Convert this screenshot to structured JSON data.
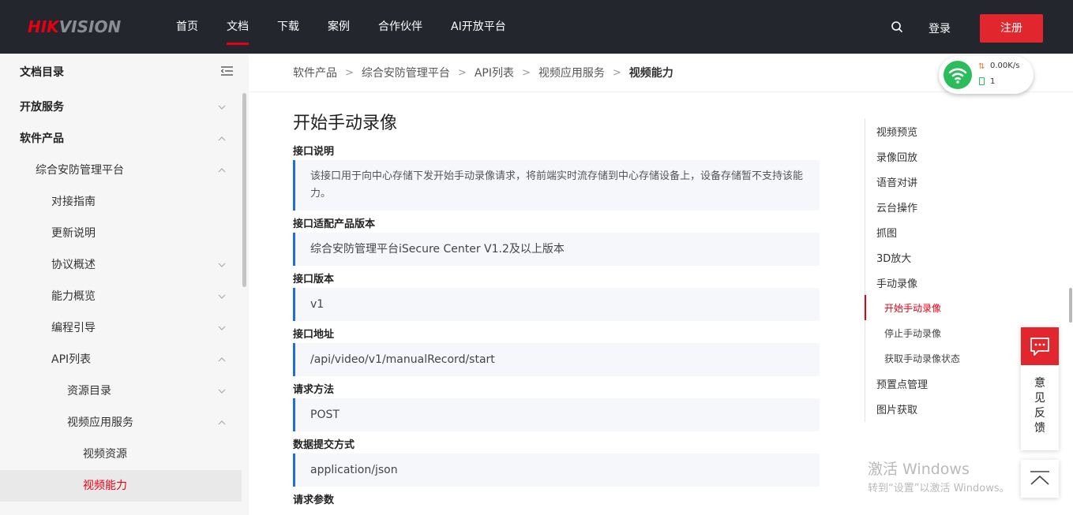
{
  "header": {
    "logo_hik": "HIK",
    "logo_vision": "VISION",
    "nav": [
      "首页",
      "文档",
      "下载",
      "案例",
      "合作伙伴",
      "AI开放平台"
    ],
    "active_nav": "文档",
    "login": "登录",
    "register": "注册",
    "search_icon": "search-icon"
  },
  "network_widget": {
    "speed": "0.00K/s",
    "count": "1",
    "icon": "wifi-icon"
  },
  "sidebar": {
    "title": "文档目录",
    "items": [
      {
        "label": "开放服务",
        "chevron": "down"
      },
      {
        "label": "软件产品",
        "chevron": "up"
      },
      {
        "label": "综合安防管理平台",
        "chevron": "up"
      },
      {
        "label": "对接指南",
        "chevron": ""
      },
      {
        "label": "更新说明",
        "chevron": ""
      },
      {
        "label": "协议概述",
        "chevron": "down"
      },
      {
        "label": "能力概览",
        "chevron": "down"
      },
      {
        "label": "编程引导",
        "chevron": "down"
      },
      {
        "label": "API列表",
        "chevron": "up"
      },
      {
        "label": "资源目录",
        "chevron": "down"
      },
      {
        "label": "视频应用服务",
        "chevron": "up"
      },
      {
        "label": "视频资源",
        "chevron": ""
      },
      {
        "label": "视频能力",
        "chevron": ""
      }
    ]
  },
  "breadcrumb": [
    "软件产品",
    "综合安防管理平台",
    "API列表",
    "视频应用服务",
    "视频能力"
  ],
  "content": {
    "title": "开始手动录像",
    "sections": [
      {
        "label": "接口说明",
        "value": "该接口用于向中心存储下发开始手动录像请求，将前端实时流存储到中心存储设备上，设备存储暂不支持该能力。"
      },
      {
        "label": "接口适配产品版本",
        "value": "综合安防管理平台iSecure Center V1.2及以上版本"
      },
      {
        "label": "接口版本",
        "value": "v1"
      },
      {
        "label": "接口地址",
        "value": "/api/video/v1/manualRecord/start"
      },
      {
        "label": "请求方法",
        "value": "POST"
      },
      {
        "label": "数据提交方式",
        "value": "application/json"
      },
      {
        "label": "请求参数",
        "value": ""
      }
    ]
  },
  "toc": {
    "items": [
      {
        "label": "视频预览",
        "level": 1
      },
      {
        "label": "录像回放",
        "level": 1
      },
      {
        "label": "语音对讲",
        "level": 1
      },
      {
        "label": "云台操作",
        "level": 1
      },
      {
        "label": "抓图",
        "level": 1
      },
      {
        "label": "3D放大",
        "level": 1
      },
      {
        "label": "手动录像",
        "level": 1
      },
      {
        "label": "开始手动录像",
        "level": 2,
        "active": true
      },
      {
        "label": "停止手动录像",
        "level": 2
      },
      {
        "label": "获取手动录像状态",
        "level": 2
      },
      {
        "label": "预置点管理",
        "level": 1
      },
      {
        "label": "图片获取",
        "level": 1
      }
    ]
  },
  "feedback": {
    "text": "意见反馈",
    "icon": "chat-icon"
  },
  "backtop": {
    "icon": "back-to-top-icon"
  },
  "watermark": {
    "line1": "激活 Windows",
    "line2": "转到“设置”以激活 Windows。"
  },
  "colors": {
    "brand_red": "#e60012",
    "header_bg": "#24262e",
    "accent_blue": "#1e6fd9"
  }
}
